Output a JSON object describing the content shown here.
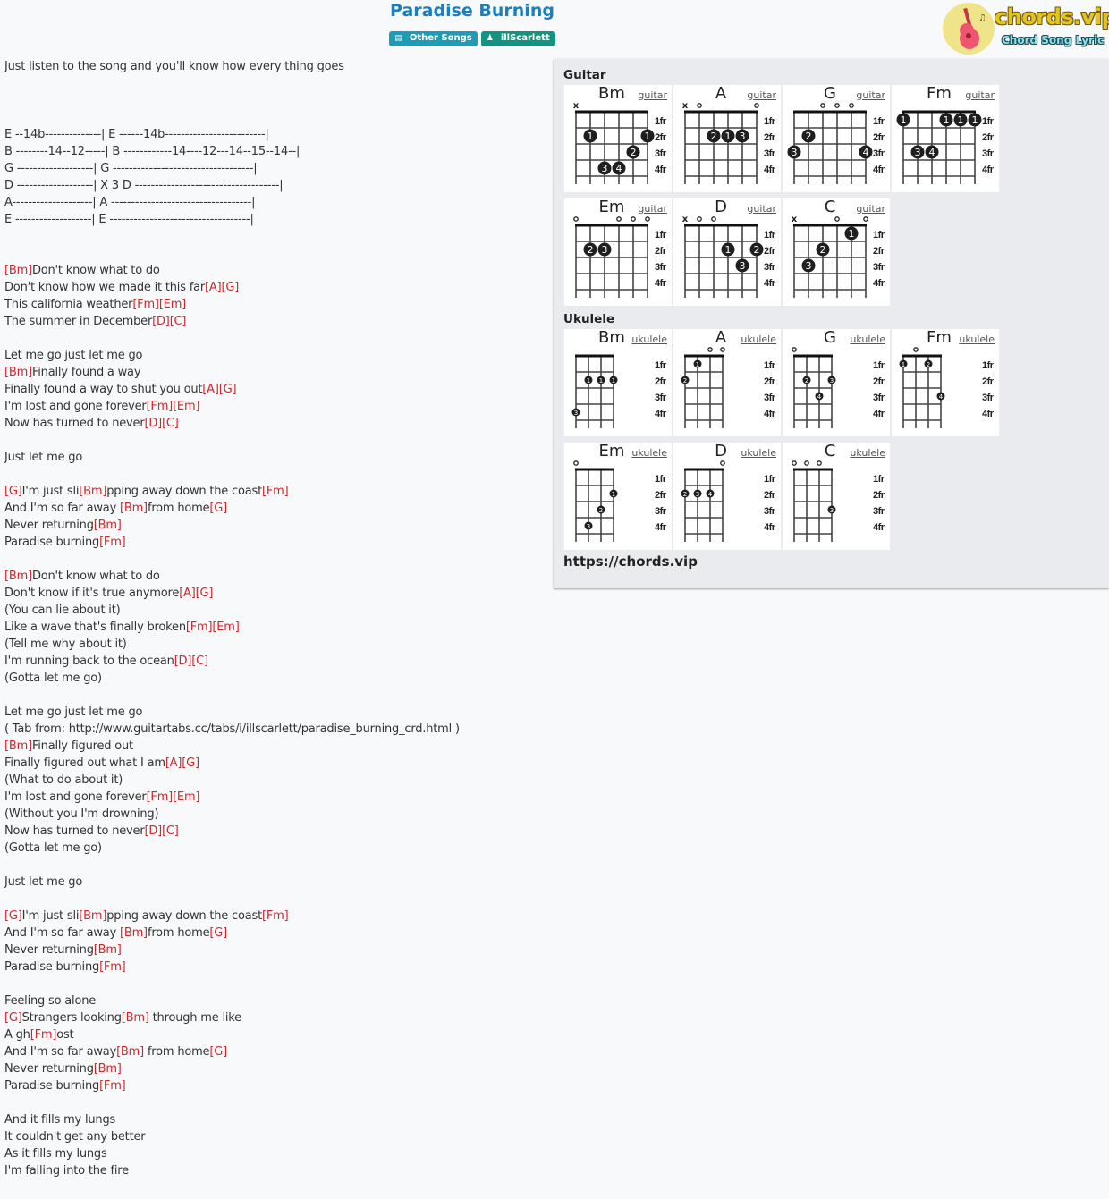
{
  "title": "Paradise Burning",
  "badges": {
    "category": {
      "icon": "book-icon",
      "label": "Other Songs"
    },
    "artist": {
      "icon": "user-icon",
      "label": "illScarlett"
    }
  },
  "logo": {
    "brand": "chords.vip",
    "tagline": "Chord Song Lyric"
  },
  "colors": {
    "title": "#1a7fc1",
    "chord": "#d3262b",
    "category_badge": "#1e9bb5",
    "artist_badge": "#139481"
  },
  "lyrics": [
    [
      {
        "t": "Just listen to the song and you'll know how every thing goes"
      }
    ],
    [],
    [],
    [],
    [
      {
        "t": "E --14b--------------| E ------14b-------------------------|"
      }
    ],
    [
      {
        "t": "B --------14--12-----| B ------------14----12---14--15--14--|"
      }
    ],
    [
      {
        "t": "G -------------------| G -----------------------------------|"
      }
    ],
    [
      {
        "t": "D -------------------| X 3 D ------------------------------------|"
      }
    ],
    [
      {
        "t": "A--------------------| A -----------------------------------|"
      }
    ],
    [
      {
        "t": "E -------------------| E -----------------------------------|"
      }
    ],
    [],
    [],
    [
      {
        "c": "[Bm]"
      },
      {
        "t": "Don't know what to do"
      }
    ],
    [
      {
        "t": "Don't know how we made it this far"
      },
      {
        "c": "[A]"
      },
      {
        "c": "[G]"
      }
    ],
    [
      {
        "t": "This california weather"
      },
      {
        "c": "[Fm]"
      },
      {
        "c": "[Em]"
      }
    ],
    [
      {
        "t": "The summer in December"
      },
      {
        "c": "[D]"
      },
      {
        "c": "[C]"
      }
    ],
    [],
    [
      {
        "t": "Let me go just let me go"
      }
    ],
    [
      {
        "c": "[Bm]"
      },
      {
        "t": "Finally found a way"
      }
    ],
    [
      {
        "t": "Finally found a way to shut you out"
      },
      {
        "c": "[A]"
      },
      {
        "c": "[G]"
      }
    ],
    [
      {
        "t": "I'm lost and gone forever"
      },
      {
        "c": "[Fm]"
      },
      {
        "c": "[Em]"
      }
    ],
    [
      {
        "t": "Now has turned to never"
      },
      {
        "c": "[D]"
      },
      {
        "c": "[C]"
      }
    ],
    [],
    [
      {
        "t": "Just let me go"
      }
    ],
    [],
    [
      {
        "c": "[G]"
      },
      {
        "t": "I'm just sli"
      },
      {
        "c": "[Bm]"
      },
      {
        "t": "pping away down the coast"
      },
      {
        "c": "[Fm]"
      }
    ],
    [
      {
        "t": "And I'm so far away "
      },
      {
        "c": "[Bm]"
      },
      {
        "t": "from home"
      },
      {
        "c": "[G]"
      }
    ],
    [
      {
        "t": "Never returning"
      },
      {
        "c": "[Bm]"
      }
    ],
    [
      {
        "t": "Paradise burning"
      },
      {
        "c": "[Fm]"
      }
    ],
    [],
    [
      {
        "c": "[Bm]"
      },
      {
        "t": "Don't know what to do"
      }
    ],
    [
      {
        "t": "Don't know if it's true anymore"
      },
      {
        "c": "[A]"
      },
      {
        "c": "[G]"
      }
    ],
    [
      {
        "t": "(You can lie about it)"
      }
    ],
    [
      {
        "t": "Like a wave that's finally broken"
      },
      {
        "c": "[Fm]"
      },
      {
        "c": "[Em]"
      }
    ],
    [
      {
        "t": "(Tell me why about it)"
      }
    ],
    [
      {
        "t": "I'm running back to the ocean"
      },
      {
        "c": "[D]"
      },
      {
        "c": "[C]"
      }
    ],
    [
      {
        "t": "(Gotta let me go)"
      }
    ],
    [],
    [
      {
        "t": "Let me go just let me go"
      }
    ],
    [
      {
        "t": "( Tab from: http://www.guitartabs.cc/tabs/i/illscarlett/paradise_burning_crd.html )"
      }
    ],
    [
      {
        "c": "[Bm]"
      },
      {
        "t": "Finally figured out"
      }
    ],
    [
      {
        "t": "Finally figured out what I am"
      },
      {
        "c": "[A]"
      },
      {
        "c": "[G]"
      }
    ],
    [
      {
        "t": "(What to do about it)"
      }
    ],
    [
      {
        "t": "I'm lost and gone forever"
      },
      {
        "c": "[Fm]"
      },
      {
        "c": "[Em]"
      }
    ],
    [
      {
        "t": "(Without you I'm drowning)"
      }
    ],
    [
      {
        "t": "Now has turned to never"
      },
      {
        "c": "[D]"
      },
      {
        "c": "[C]"
      }
    ],
    [
      {
        "t": "(Gotta let me go)"
      }
    ],
    [],
    [
      {
        "t": "Just let me go"
      }
    ],
    [],
    [
      {
        "c": "[G]"
      },
      {
        "t": "I'm just sli"
      },
      {
        "c": "[Bm]"
      },
      {
        "t": "pping away down the coast"
      },
      {
        "c": "[Fm]"
      }
    ],
    [
      {
        "t": "And I'm so far away "
      },
      {
        "c": "[Bm]"
      },
      {
        "t": "from home"
      },
      {
        "c": "[G]"
      }
    ],
    [
      {
        "t": "Never returning"
      },
      {
        "c": "[Bm]"
      }
    ],
    [
      {
        "t": "Paradise burning"
      },
      {
        "c": "[Fm]"
      }
    ],
    [],
    [
      {
        "t": "Feeling so alone"
      }
    ],
    [
      {
        "c": "[G]"
      },
      {
        "t": "Strangers looking"
      },
      {
        "c": "[Bm]"
      },
      {
        "t": " through me like"
      }
    ],
    [
      {
        "t": "A gh"
      },
      {
        "c": "[Fm]"
      },
      {
        "t": "ost"
      }
    ],
    [
      {
        "t": "And I'm so far away"
      },
      {
        "c": "[Bm]"
      },
      {
        "t": " from home"
      },
      {
        "c": "[G]"
      }
    ],
    [
      {
        "t": "Never returning"
      },
      {
        "c": "[Bm]"
      }
    ],
    [
      {
        "t": "Paradise burning"
      },
      {
        "c": "[Fm]"
      }
    ],
    [],
    [
      {
        "t": "And it fills my lungs"
      }
    ],
    [
      {
        "t": "It couldn't get any better"
      }
    ],
    [
      {
        "t": "As it fills my lungs"
      }
    ],
    [
      {
        "t": "I'm falling into the fire"
      }
    ]
  ],
  "chord_panel": {
    "guitar_label": "Guitar",
    "ukulele_label": "Ukulele",
    "fret_labels": [
      "1fr",
      "2fr",
      "3fr",
      "4fr"
    ],
    "guitar": [
      {
        "name": "Bm",
        "link": "guitar",
        "strings": [
          "x",
          "",
          "",
          "",
          "",
          ""
        ],
        "dots": [
          {
            "s": 1,
            "f": 2,
            "n": "1"
          },
          {
            "s": 5,
            "f": 2,
            "n": "1"
          },
          {
            "s": 4,
            "f": 3,
            "n": "2"
          },
          {
            "s": 2,
            "f": 4,
            "n": "3"
          },
          {
            "s": 3,
            "f": 4,
            "n": "4"
          }
        ]
      },
      {
        "name": "A",
        "link": "guitar",
        "strings": [
          "x",
          "o",
          "",
          "",
          "",
          "o"
        ],
        "dots": [
          {
            "s": 2,
            "f": 2,
            "n": "2"
          },
          {
            "s": 3,
            "f": 2,
            "n": "1"
          },
          {
            "s": 4,
            "f": 2,
            "n": "3"
          }
        ]
      },
      {
        "name": "G",
        "link": "guitar",
        "strings": [
          "",
          "",
          "o",
          "o",
          "o",
          ""
        ],
        "dots": [
          {
            "s": 1,
            "f": 2,
            "n": "2"
          },
          {
            "s": 0,
            "f": 3,
            "n": "3"
          },
          {
            "s": 5,
            "f": 3,
            "n": "4"
          }
        ]
      },
      {
        "name": "Fm",
        "link": "guitar",
        "strings": [
          "",
          "",
          "",
          "",
          "",
          ""
        ],
        "dots": [
          {
            "s": 0,
            "f": 1,
            "n": "1"
          },
          {
            "s": 3,
            "f": 1,
            "n": "1"
          },
          {
            "s": 4,
            "f": 1,
            "n": "1"
          },
          {
            "s": 5,
            "f": 1,
            "n": "1"
          },
          {
            "s": 1,
            "f": 3,
            "n": "3"
          },
          {
            "s": 2,
            "f": 3,
            "n": "4"
          }
        ]
      },
      {
        "name": "Em",
        "link": "guitar",
        "strings": [
          "o",
          "",
          "",
          "o",
          "o",
          "o"
        ],
        "dots": [
          {
            "s": 1,
            "f": 2,
            "n": "2"
          },
          {
            "s": 2,
            "f": 2,
            "n": "3"
          }
        ]
      },
      {
        "name": "D",
        "link": "guitar",
        "strings": [
          "x",
          "o",
          "o",
          "",
          "",
          ""
        ],
        "dots": [
          {
            "s": 3,
            "f": 2,
            "n": "1"
          },
          {
            "s": 5,
            "f": 2,
            "n": "2"
          },
          {
            "s": 4,
            "f": 3,
            "n": "3"
          }
        ]
      },
      {
        "name": "C",
        "link": "guitar",
        "strings": [
          "x",
          "",
          "",
          "o",
          "",
          "o"
        ],
        "dots": [
          {
            "s": 4,
            "f": 1,
            "n": "1"
          },
          {
            "s": 2,
            "f": 2,
            "n": "2"
          },
          {
            "s": 1,
            "f": 3,
            "n": "3"
          }
        ]
      }
    ],
    "ukulele": [
      {
        "name": "Bm",
        "link": "ukulele",
        "strings": [
          "",
          "",
          "",
          ""
        ],
        "dots": [
          {
            "s": 1,
            "f": 2,
            "n": "1"
          },
          {
            "s": 2,
            "f": 2,
            "n": "1"
          },
          {
            "s": 3,
            "f": 2,
            "n": "1"
          },
          {
            "s": 0,
            "f": 4,
            "n": "3"
          }
        ]
      },
      {
        "name": "A",
        "link": "ukulele",
        "strings": [
          "",
          "",
          "o",
          "o"
        ],
        "dots": [
          {
            "s": 1,
            "f": 1,
            "n": "1"
          },
          {
            "s": 0,
            "f": 2,
            "n": "2"
          }
        ]
      },
      {
        "name": "G",
        "link": "ukulele",
        "strings": [
          "o",
          "",
          "",
          ""
        ],
        "dots": [
          {
            "s": 1,
            "f": 2,
            "n": "2"
          },
          {
            "s": 3,
            "f": 2,
            "n": "3"
          },
          {
            "s": 2,
            "f": 3,
            "n": "4"
          }
        ]
      },
      {
        "name": "Fm",
        "link": "ukulele",
        "strings": [
          "",
          "o",
          "",
          ""
        ],
        "dots": [
          {
            "s": 0,
            "f": 1,
            "n": "1"
          },
          {
            "s": 2,
            "f": 1,
            "n": "2"
          },
          {
            "s": 3,
            "f": 3,
            "n": "4"
          }
        ]
      },
      {
        "name": "Em",
        "link": "ukulele",
        "strings": [
          "o",
          "",
          "",
          ""
        ],
        "dots": [
          {
            "s": 3,
            "f": 2,
            "n": "1"
          },
          {
            "s": 2,
            "f": 3,
            "n": "2"
          },
          {
            "s": 1,
            "f": 4,
            "n": "3"
          }
        ]
      },
      {
        "name": "D",
        "link": "ukulele",
        "strings": [
          "",
          "",
          "",
          "o"
        ],
        "dots": [
          {
            "s": 0,
            "f": 2,
            "n": "2"
          },
          {
            "s": 1,
            "f": 2,
            "n": "3"
          },
          {
            "s": 2,
            "f": 2,
            "n": "4"
          }
        ]
      },
      {
        "name": "C",
        "link": "ukulele",
        "strings": [
          "o",
          "o",
          "o",
          ""
        ],
        "dots": [
          {
            "s": 3,
            "f": 3,
            "n": "3"
          }
        ]
      }
    ],
    "site_url": "https://chords.vip"
  }
}
